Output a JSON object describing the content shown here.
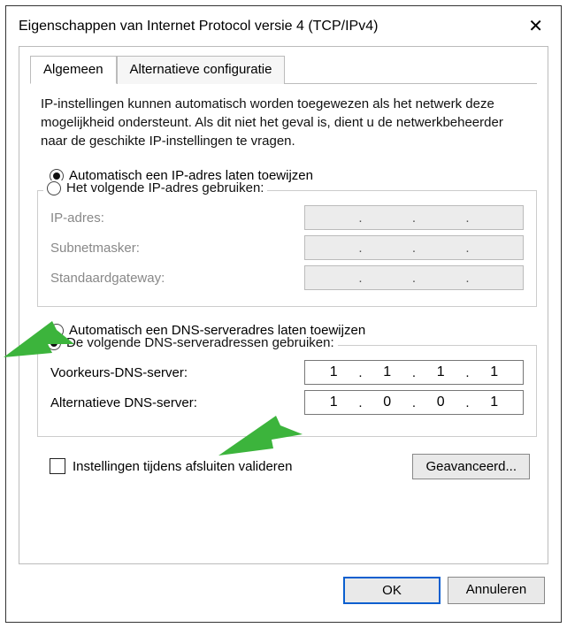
{
  "window": {
    "title": "Eigenschappen van Internet Protocol versie 4 (TCP/IPv4)"
  },
  "tabs": {
    "general": "Algemeen",
    "alternate": "Alternatieve configuratie"
  },
  "description": "IP-instellingen kunnen automatisch worden toegewezen als het netwerk deze mogelijkheid ondersteunt. Als dit niet het geval is, dient u de netwerkbeheerder naar de geschikte IP-instellingen te vragen.",
  "ip_section": {
    "auto_label": "Automatisch een IP-adres laten toewijzen",
    "manual_label": "Het volgende IP-adres gebruiken:",
    "ip_label": "IP-adres:",
    "subnet_label": "Subnetmasker:",
    "gateway_label": "Standaardgateway:",
    "ip_value": [
      "",
      "",
      "",
      ""
    ],
    "subnet_value": [
      "",
      "",
      "",
      ""
    ],
    "gateway_value": [
      "",
      "",
      "",
      ""
    ]
  },
  "dns_section": {
    "auto_label": "Automatisch een DNS-serveradres laten toewijzen",
    "manual_label": "De volgende DNS-serveradressen gebruiken:",
    "pref_label": "Voorkeurs-DNS-server:",
    "alt_label": "Alternatieve DNS-server:",
    "pref_value": [
      "1",
      "1",
      "1",
      "1"
    ],
    "alt_value": [
      "1",
      "0",
      "0",
      "1"
    ]
  },
  "validate_label": "Instellingen tijdens afsluiten valideren",
  "advanced_label": "Geavanceerd...",
  "ok_label": "OK",
  "cancel_label": "Annuleren"
}
